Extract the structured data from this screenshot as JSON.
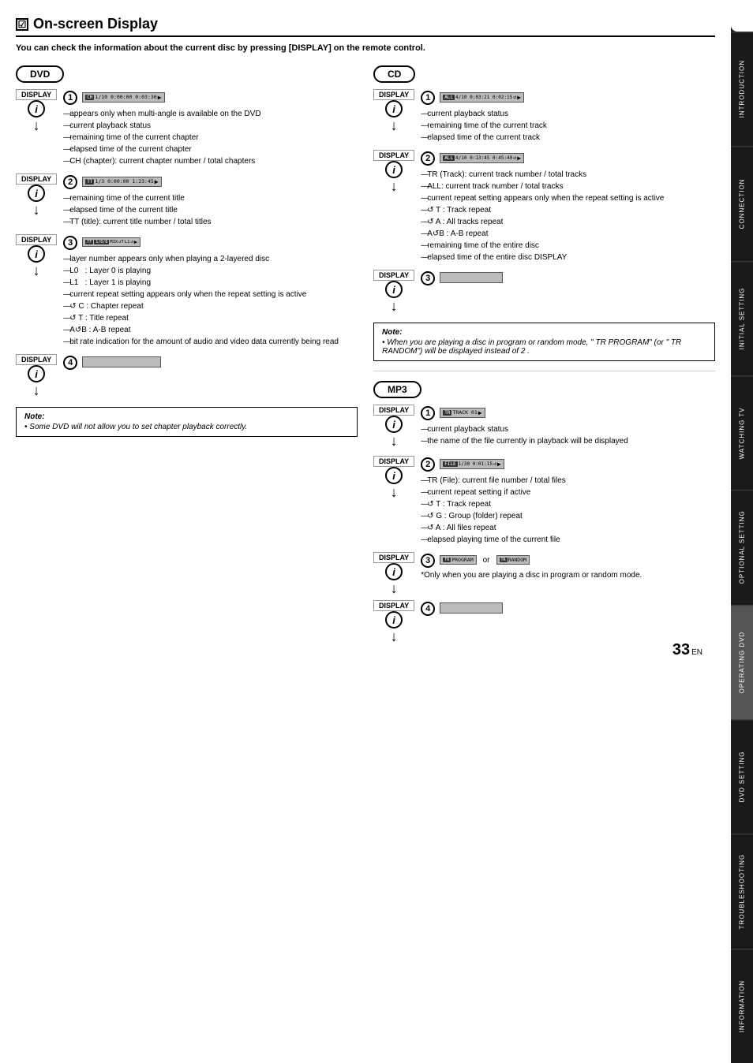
{
  "page": {
    "number": "33",
    "lang": "EN"
  },
  "sidebar": {
    "sections": [
      {
        "label": "INTRODUCTION",
        "active": false
      },
      {
        "label": "CONNECTION",
        "active": false
      },
      {
        "label": "INITIAL SETTING",
        "active": false
      },
      {
        "label": "WATCHING TV",
        "active": false
      },
      {
        "label": "OPTIONAL SETTING",
        "active": false
      },
      {
        "label": "OPERATING DVD",
        "active": true
      },
      {
        "label": "DVD SETTING",
        "active": false
      },
      {
        "label": "TROUBLESHOOTING",
        "active": false
      },
      {
        "label": "INFORMATION",
        "active": false
      }
    ]
  },
  "title": {
    "checkbox": "☑",
    "text": "On-screen Display"
  },
  "subtitle": "You can check the information about the current disc by pressing [DISPLAY] on the remote control.",
  "dvd": {
    "label": "DVD",
    "note": {
      "title": "Note:",
      "text": "• Some DVD will not allow you to set chapter playback correctly."
    },
    "display_label": "DISPLAY",
    "steps": [
      {
        "num": "1",
        "screen": "CH  1/10  0:00:00  0:03:30  ▶",
        "annotations": [
          "appears only when multi-angle is available on the DVD",
          "current playback status",
          "remaining time of the current chapter",
          "elapsed time of the current chapter",
          "CH (chapter): current chapter number / total chapters"
        ]
      },
      {
        "num": "2",
        "screen": "TT  1/3  0:00:00  1:23:45  ▶",
        "annotations": [
          "remaining time of the current title",
          "elapsed time of the current title",
          "TT (title): current title number / total titles"
        ]
      },
      {
        "num": "3",
        "screen": "TF  1/0/8  MIX  ↺T  L1  ↺  ▶",
        "annotations": [
          "layer number appears only when playing a 2-layered disc",
          "L0   : Layer 0 is playing",
          "L1   : Layer 1 is playing",
          "current repeat setting appears only when the repeat setting is active",
          "↺ C  : Chapter repeat",
          "↺ T  : Title repeat",
          "A↺B : A-B repeat",
          "bit rate indication for the amount of audio and video data currently being read"
        ]
      },
      {
        "num": "4",
        "screen": ""
      }
    ]
  },
  "cd": {
    "label": "CD",
    "display_label": "DISPLAY",
    "note": {
      "title": "Note:",
      "text": "• When you are playing a disc in program or random mode, \" TR PROGRAM\" (or \" TR RANDOM\") will be displayed instead of 2 ."
    },
    "steps": [
      {
        "num": "1",
        "screen": "ALL  4/10  0:03:21  0:02:15  ↺  ▶",
        "annotations": [
          "current playback status",
          "remaining time of the current track",
          "elapsed time of the current track"
        ]
      },
      {
        "num": "2",
        "screen": "ALL  4/10  0:13:45  0:45:40  ↺  ▶",
        "annotations": [
          "TR (Track): current track number / total tracks",
          "ALL: current track number / total tracks",
          "current repeat setting appears only when the repeat setting is active",
          "↺ T  : Track repeat",
          "↺ A  : All tracks repeat",
          "A↺B : A-B repeat",
          "remaining time of the entire disc",
          "elapsed time of the entire disc"
        ]
      },
      {
        "num": "3",
        "screen": ""
      }
    ]
  },
  "mp3": {
    "label": "MP3",
    "display_label": "DISPLAY",
    "steps": [
      {
        "num": "1",
        "screen": "TR  TRACK 01  ▶",
        "annotations": [
          "current playback status",
          "the name of the file currently in playback will be displayed"
        ]
      },
      {
        "num": "2",
        "screen": "FILE  1/30  0:01:15  ↺  ▶",
        "annotations": [
          "TR (File): current file number / total files",
          "current repeat setting if active",
          "↺ T  : Track repeat",
          "↺ G  : Group (folder) repeat",
          "↺ A  : All files repeat",
          "elapsed playing time of the current file"
        ]
      },
      {
        "num": "3",
        "screen_left": "TR  PROGRAM",
        "screen_right": "TR  RANDOM",
        "or_text": "or",
        "note": "*Only when you are playing a disc in program or random mode.",
        "annotations": []
      },
      {
        "num": "4",
        "screen": ""
      }
    ]
  }
}
